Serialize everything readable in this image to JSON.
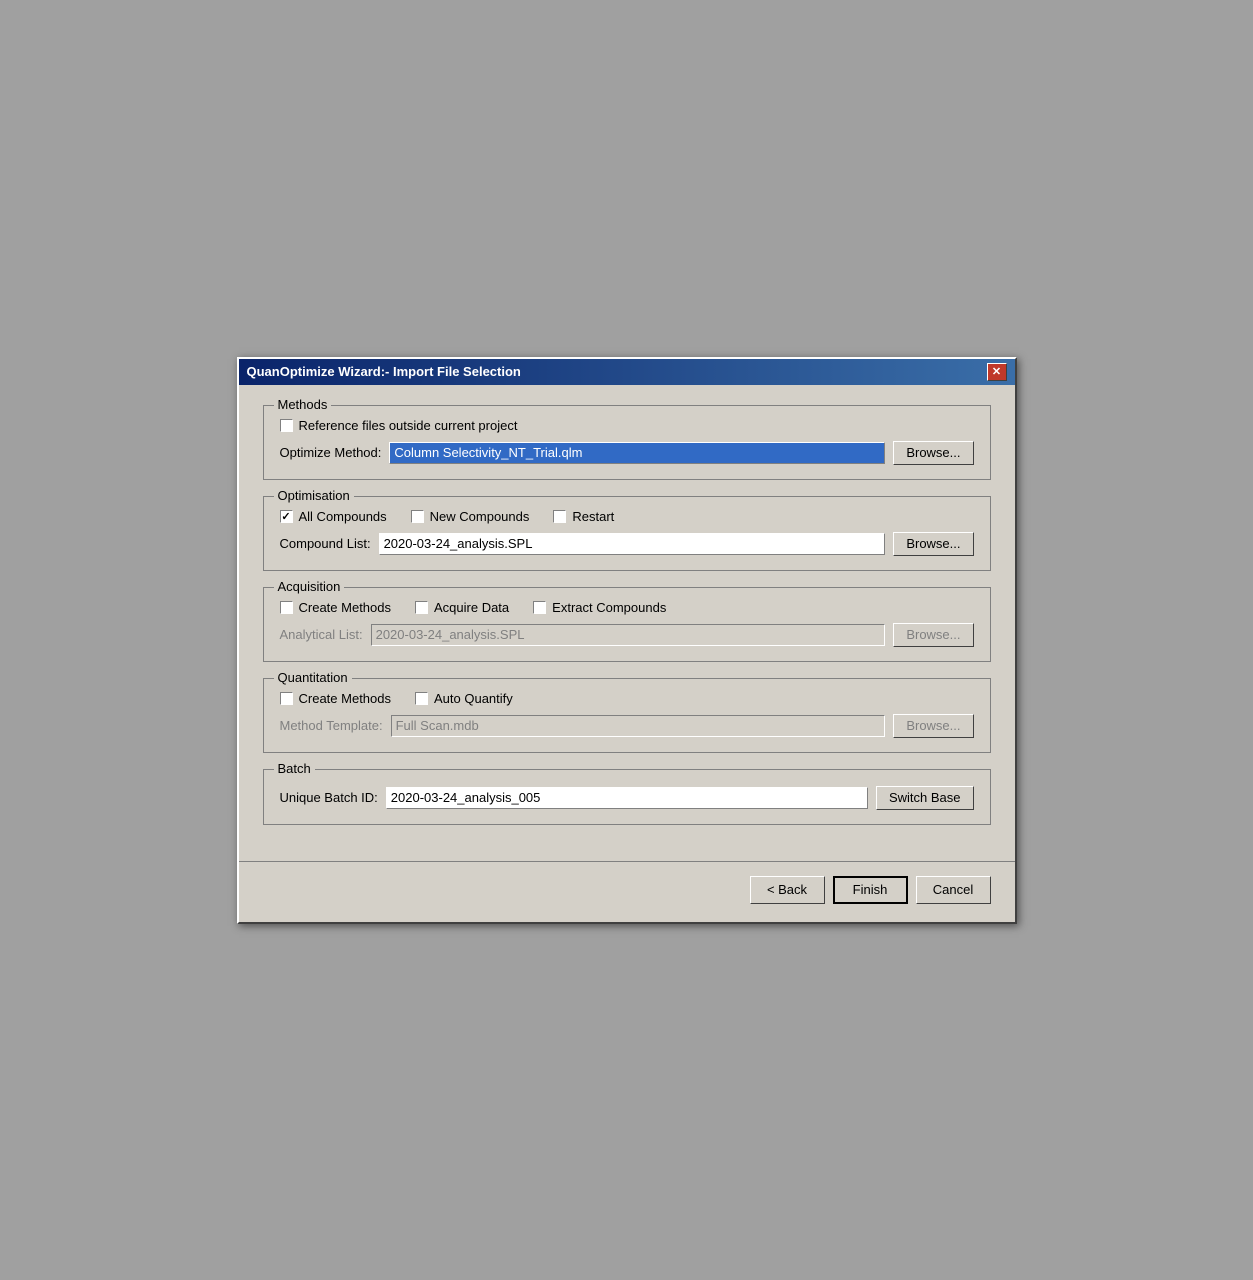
{
  "dialog": {
    "title": "QuanOptimize Wizard:- Import File Selection",
    "close_label": "✕"
  },
  "methods_group": {
    "label": "Methods",
    "reference_checkbox_label": "Reference files outside current project",
    "reference_checked": false,
    "optimize_method_label": "Optimize Method:",
    "optimize_method_value": "Column Selectivity_NT_Trial.qlm",
    "browse_label": "Browse..."
  },
  "optimisation_group": {
    "label": "Optimisation",
    "all_compounds_label": "All Compounds",
    "all_compounds_checked": true,
    "new_compounds_label": "New Compounds",
    "new_compounds_checked": false,
    "restart_label": "Restart",
    "restart_checked": false,
    "compound_list_label": "Compound List:",
    "compound_list_value": "2020-03-24_analysis.SPL",
    "browse_label": "Browse..."
  },
  "acquisition_group": {
    "label": "Acquisition",
    "create_methods_label": "Create Methods",
    "create_methods_checked": false,
    "acquire_data_label": "Acquire Data",
    "acquire_data_checked": false,
    "extract_compounds_label": "Extract Compounds",
    "extract_compounds_checked": false,
    "analytical_list_label": "Analytical List:",
    "analytical_list_value": "2020-03-24_analysis.SPL",
    "browse_label": "Browse..."
  },
  "quantitation_group": {
    "label": "Quantitation",
    "create_methods_label": "Create Methods",
    "create_methods_checked": false,
    "auto_quantify_label": "Auto Quantify",
    "auto_quantify_checked": false,
    "method_template_label": "Method Template:",
    "method_template_value": "Full Scan.mdb",
    "browse_label": "Browse..."
  },
  "batch_group": {
    "label": "Batch",
    "unique_batch_id_label": "Unique Batch ID:",
    "unique_batch_id_value": "2020-03-24_analysis_005",
    "switch_base_label": "Switch Base"
  },
  "footer": {
    "back_label": "< Back",
    "finish_label": "Finish",
    "cancel_label": "Cancel"
  }
}
